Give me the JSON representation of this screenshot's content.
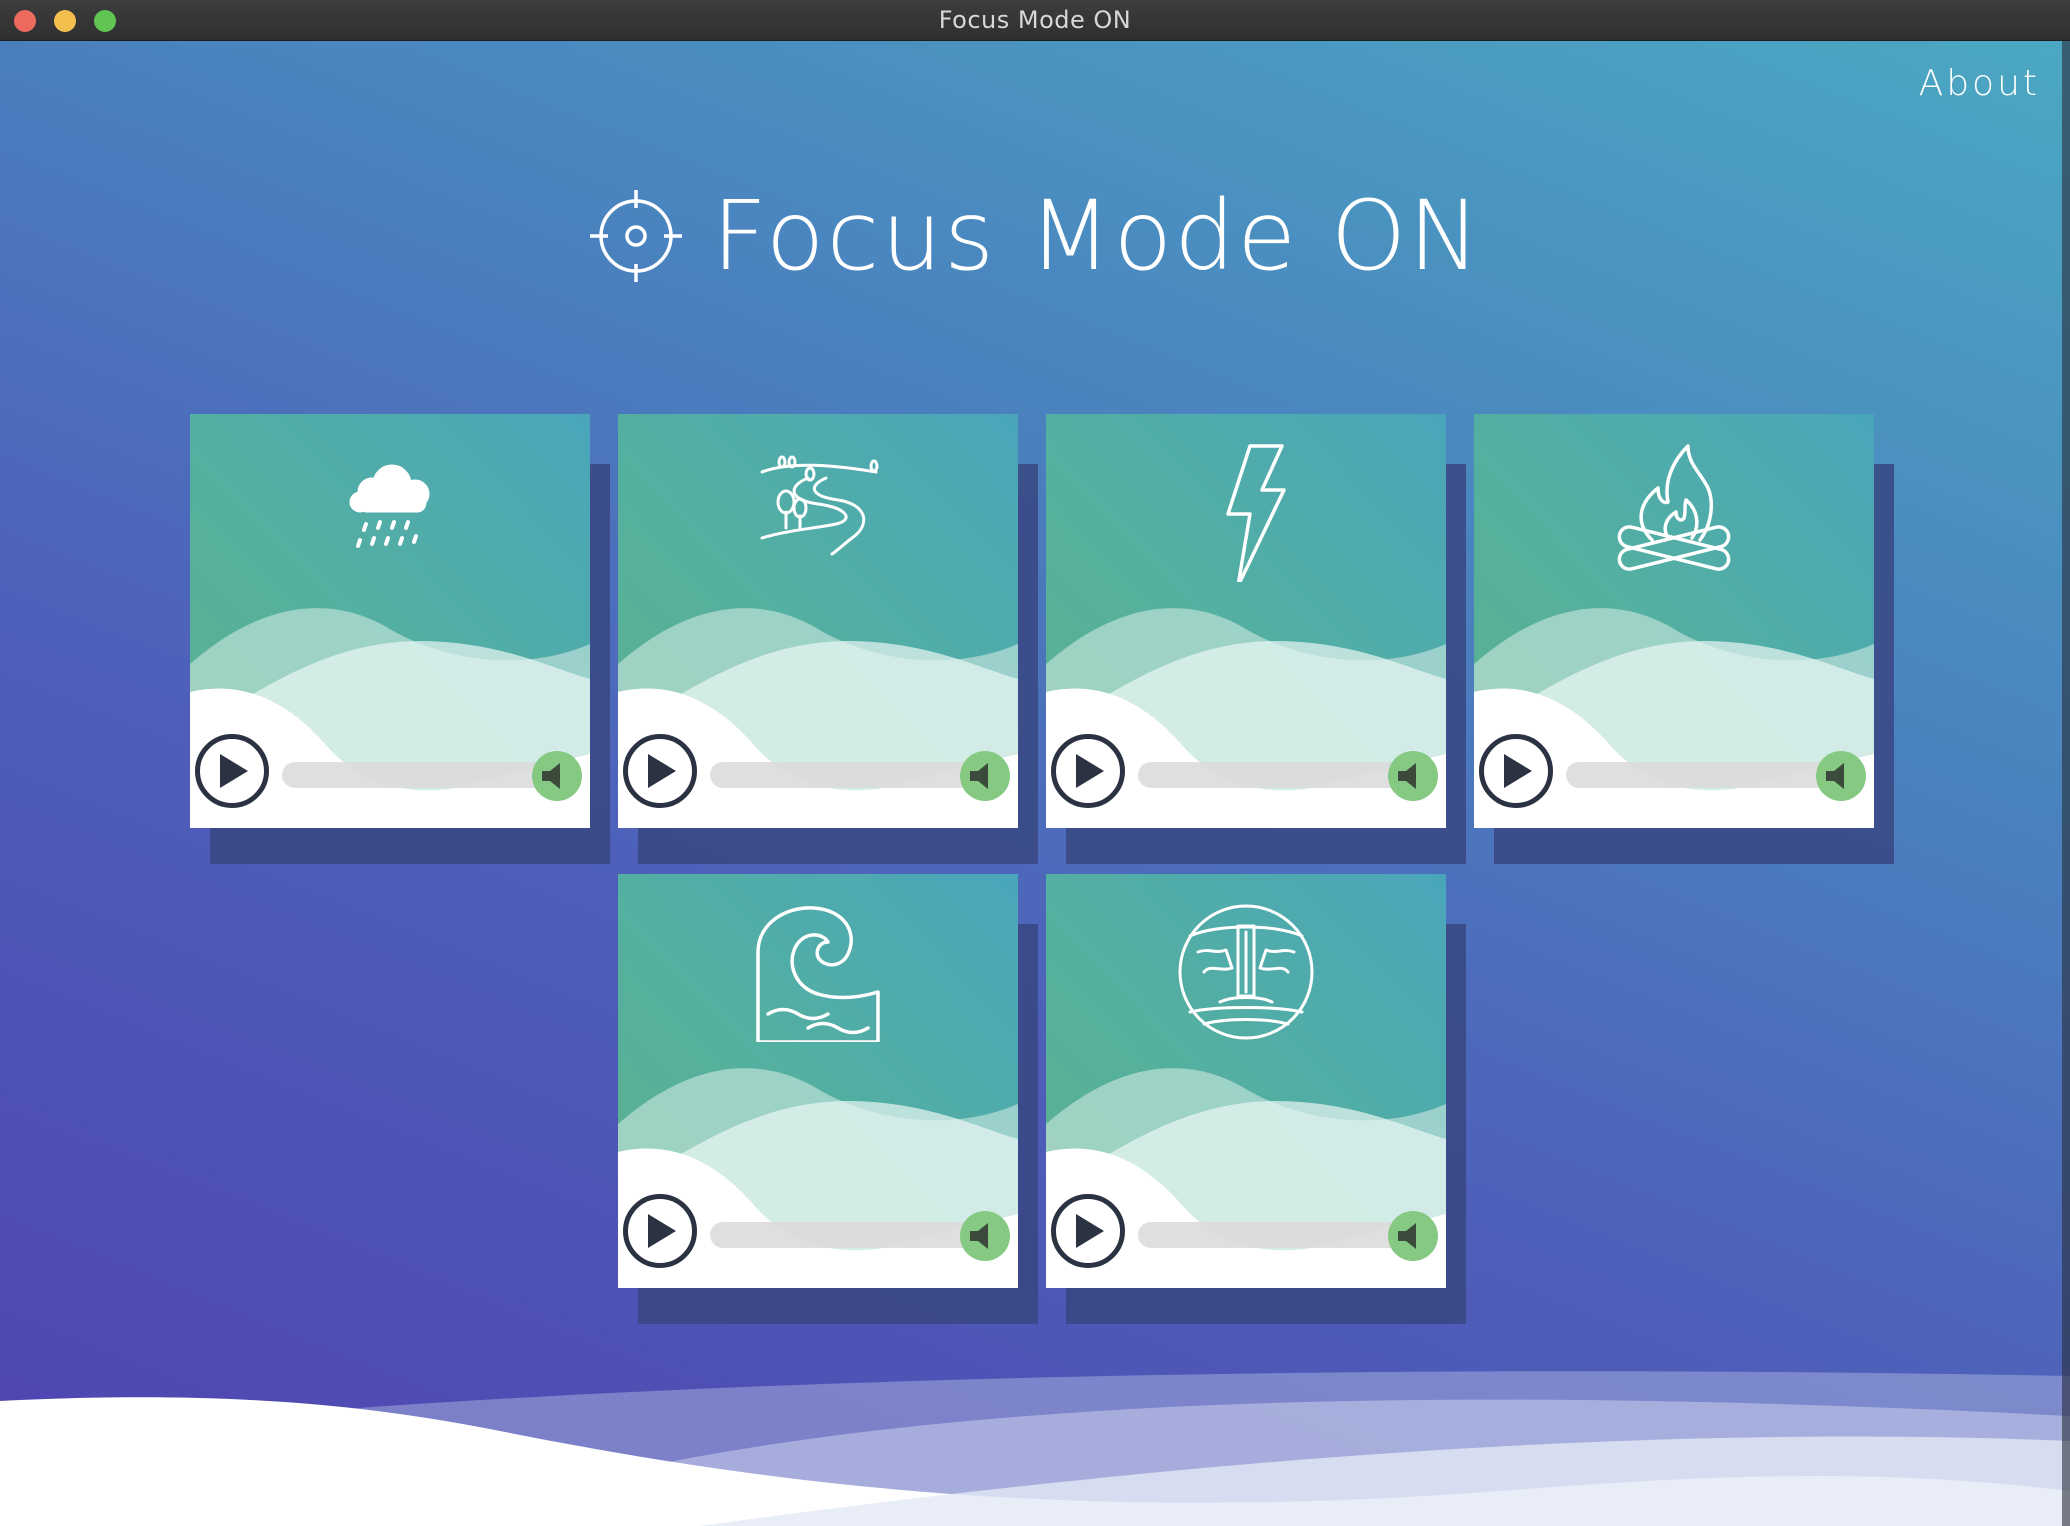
{
  "window": {
    "title": "Focus Mode ON"
  },
  "nav": {
    "about_label": "About"
  },
  "header": {
    "title": "Focus Mode ON",
    "icon": "crosshair-icon"
  },
  "sounds": [
    {
      "id": "rain",
      "icon": "rain-cloud-icon",
      "volume": 0.95
    },
    {
      "id": "countryside",
      "icon": "countryside-road-icon",
      "volume": 0.95
    },
    {
      "id": "thunder",
      "icon": "lightning-bolt-icon",
      "volume": 0.95
    },
    {
      "id": "campfire",
      "icon": "campfire-icon",
      "volume": 0.95
    },
    {
      "id": "ocean",
      "icon": "ocean-wave-icon",
      "volume": 0.95
    },
    {
      "id": "waterfall",
      "icon": "waterfall-icon",
      "volume": 0.95
    }
  ],
  "colors": {
    "background_start": "#4f44b0",
    "background_end": "#4ba8c2",
    "tile_green": "#5cb08d",
    "tile_teal": "#4aa5bb",
    "play_button": "#2b3242",
    "volume_knob": "#86c983"
  }
}
